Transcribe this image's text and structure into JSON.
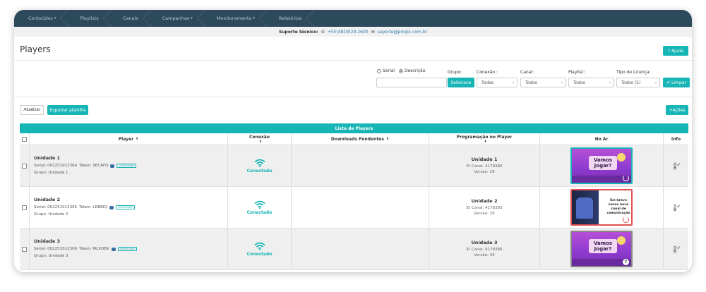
{
  "nav": {
    "items": [
      {
        "label": "Conteúdos",
        "dropdown": true
      },
      {
        "label": "Playlists",
        "dropdown": false
      },
      {
        "label": "Canais",
        "dropdown": false
      },
      {
        "label": "Campanhas",
        "dropdown": true
      },
      {
        "label": "Monitoramento",
        "dropdown": true
      },
      {
        "label": "Relatórios",
        "dropdown": false
      }
    ],
    "caret": "▾"
  },
  "support": {
    "label": "Suporte técnico:",
    "phone": "+55(48)3029-2600",
    "email": "suporte@progic.com.br"
  },
  "page": {
    "title": "Players",
    "help_label": "Ajuda"
  },
  "filters": {
    "radio_serial": "Serial",
    "radio_description": "Descrição",
    "selected_radio": "Descrição",
    "search_value": "",
    "group_label": "Grupo:",
    "group_button": "Selecione",
    "connection_label": "Conexão :",
    "connection_value": "Todas",
    "channel_label": "Canal:",
    "channel_value": "Todos",
    "playlist_label": "Playlist:",
    "playlist_value": "Todos",
    "license_label": "Tipo de Licença:",
    "license_value": "Todos (5)",
    "clear_label": "Limpar"
  },
  "toolbar": {
    "refresh_label": "Atualizar",
    "export_label": "Exportar planilha",
    "actions_label": "+Ações"
  },
  "table": {
    "caption": "Lista de Players",
    "columns": {
      "player": "Player",
      "connection": "Conexão",
      "downloads": "Downloads Pendentes",
      "programming": "Programação no Player",
      "on_air": "No Ar",
      "info": "Info"
    },
    "sort_icon": "⬍",
    "rows": [
      {
        "name": "Unidade 1",
        "serial": "Serial: 002251012364",
        "token": "Token: 9ECAFQ",
        "license": "LICENCIADO",
        "group": "Grupo: Unidade 1",
        "connection": "Conectado",
        "downloads": "",
        "program_name": "Unidade 1",
        "channel_id": "ID Canal: 4178380",
        "version": "Versão: 29",
        "thumb_text": "Vamos Jogar?",
        "thumb_style": "green"
      },
      {
        "name": "Unidade 2",
        "serial": "Serial: 002251012365",
        "token": "Token: LRBBIQ",
        "license": "LICENCIADO",
        "group": "Grupo: Unidade 2",
        "connection": "Conectado",
        "downloads": "",
        "program_name": "Unidade 2",
        "channel_id": "ID Canal: 4178383",
        "version": "Versão: 29",
        "thumb_text": "Em breve nosso novo canal de comunicação",
        "thumb_style": "red"
      },
      {
        "name": "Unidade 3",
        "serial": "Serial: 002251012366",
        "token": "Token: MLXDBV",
        "license": "LICENCIADO",
        "group": "Grupo: Unidade 3",
        "connection": "Conectado",
        "downloads": "",
        "program_name": "Unidade 3",
        "channel_id": "ID Canal: 4178386",
        "version": "Versão: 29",
        "thumb_text": "Vamos Jogar?",
        "thumb_style": "grey"
      }
    ]
  },
  "colors": {
    "nav_bg": "#2d4a5c",
    "accent": "#17b5b5",
    "status_ok": "#17b5b5",
    "status_error": "#e45050"
  },
  "icons": {
    "phone": "phone-icon",
    "email": "envelope-icon",
    "wifi": "wifi-icon",
    "info": "thermometer-check-icon",
    "power": "power-icon",
    "help": "question-icon",
    "clear": "eraser-icon"
  }
}
